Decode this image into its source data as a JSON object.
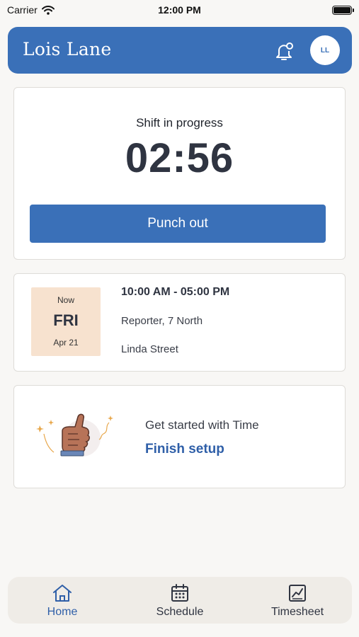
{
  "status_bar": {
    "carrier": "Carrier",
    "time": "12:00 PM"
  },
  "header": {
    "title": "Lois Lane",
    "avatar_initials": "LL",
    "notification_icon": "bell-icon"
  },
  "shift": {
    "label": "Shift in progress",
    "timer": "02:56",
    "punch_button": "Punch out"
  },
  "schedule": {
    "now_label": "Now",
    "day": "FRI",
    "date": "Apr 21",
    "hours": "10:00 AM - 05:00 PM",
    "role": "Reporter, 7 North",
    "location": "Linda Street"
  },
  "setup": {
    "prompt": "Get started with Time",
    "action": "Finish setup",
    "illustration": "thumbs-up-illustration"
  },
  "tabs": [
    {
      "label": "Home",
      "icon": "home-icon",
      "active": true
    },
    {
      "label": "Schedule",
      "icon": "calendar-icon",
      "active": false
    },
    {
      "label": "Timesheet",
      "icon": "chart-icon",
      "active": false
    }
  ],
  "colors": {
    "brand": "#3a70b8",
    "link": "#2f5fa8",
    "date_bg": "#f7e2cf",
    "background": "#f8f7f5"
  }
}
